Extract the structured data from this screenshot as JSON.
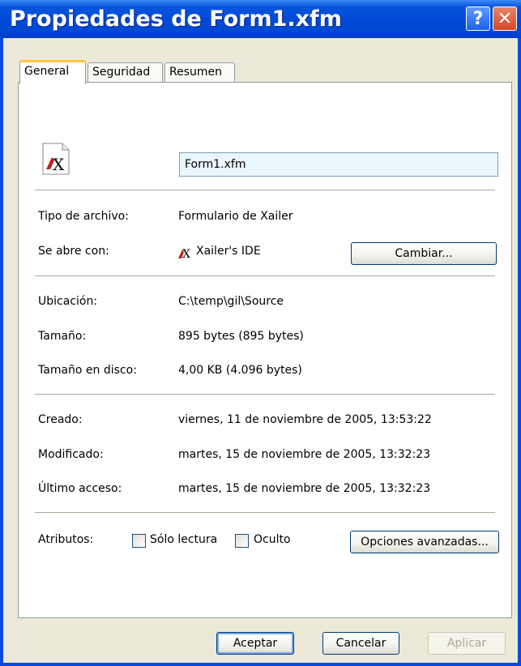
{
  "window": {
    "title": "Propiedades de Form1.xfm",
    "help_label": "?",
    "close_label": "✕"
  },
  "tabs": [
    {
      "label": "General",
      "active": true
    },
    {
      "label": "Seguridad",
      "active": false
    },
    {
      "label": "Resumen",
      "active": false
    }
  ],
  "file": {
    "icon": "xailer-file-icon",
    "name": "Form1.xfm"
  },
  "details": {
    "tipo_label": "Tipo de archivo:",
    "tipo_value": "Formulario de Xailer",
    "abre_label": "Se abre con:",
    "abre_value": "Xailer's IDE",
    "cambiar_label": "Cambiar...",
    "ubicacion_label": "Ubicación:",
    "ubicacion_value": "C:\\temp\\gil\\Source",
    "tamano_label": "Tamaño:",
    "tamano_value": "895 bytes (895 bytes)",
    "disco_label": "Tamaño en disco:",
    "disco_value": "4,00 KB (4.096 bytes)",
    "creado_label": "Creado:",
    "creado_value": "viernes, 11 de noviembre de 2005, 13:53:22",
    "modificado_label": "Modificado:",
    "modificado_value": "martes, 15 de noviembre de 2005, 13:32:23",
    "acceso_label": "Último acceso:",
    "acceso_value": "martes, 15 de noviembre de 2005, 13:32:23"
  },
  "attributes": {
    "label": "Atributos:",
    "readonly_label": "Sólo lectura",
    "readonly_checked": false,
    "hidden_label": "Oculto",
    "hidden_checked": false,
    "advanced_label": "Opciones avanzadas..."
  },
  "footer": {
    "ok_label": "Aceptar",
    "cancel_label": "Cancelar",
    "apply_label": "Aplicar"
  },
  "colors": {
    "titlebar": "#0049d4",
    "dialog_face": "#ece9d8",
    "active_tab_accent": "#ffc83c"
  }
}
